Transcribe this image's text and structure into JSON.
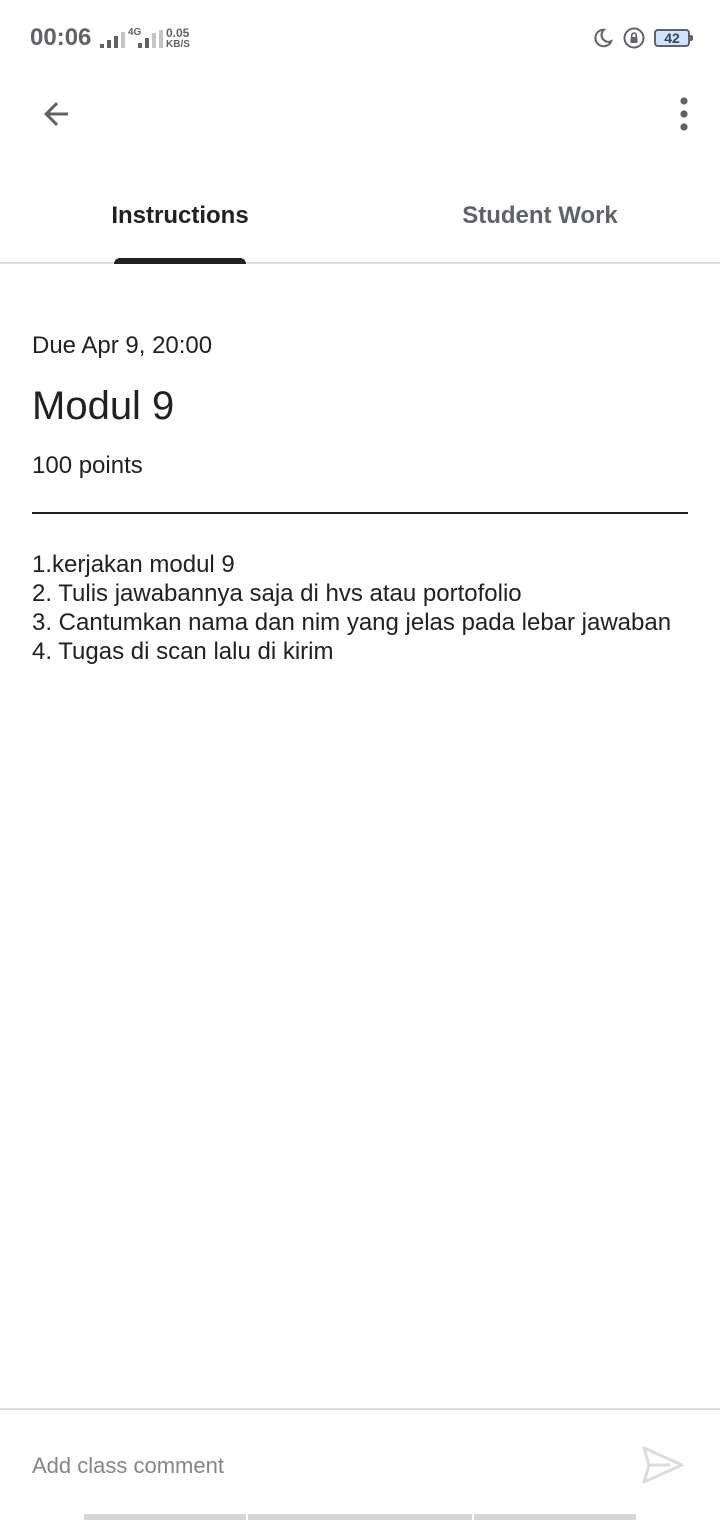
{
  "status_bar": {
    "time": "00:06",
    "network_type": "4G",
    "speed_value": "0.05",
    "speed_unit": "KB/S",
    "battery_level": "42"
  },
  "toolbar": {
    "back_icon": "arrow-back-icon",
    "more_icon": "more-vert-icon"
  },
  "tabs": [
    {
      "label": "Instructions",
      "active": true
    },
    {
      "label": "Student Work",
      "active": false
    }
  ],
  "assignment": {
    "due": "Due Apr 9, 20:00",
    "title": "Modul 9",
    "points": "100 points",
    "instructions": "1.kerjakan modul 9\n2. Tulis jawabannya saja di hvs atau portofolio\n3. Cantumkan nama dan nim yang jelas pada lebar jawaban\n4. Tugas di scan lalu di kirim"
  },
  "comment": {
    "placeholder": "Add class comment",
    "value": "",
    "send_icon": "send-icon"
  },
  "colors": {
    "text_primary": "#202124",
    "text_secondary": "#5f6368",
    "divider": "#dadce0",
    "background": "#ffffff"
  }
}
